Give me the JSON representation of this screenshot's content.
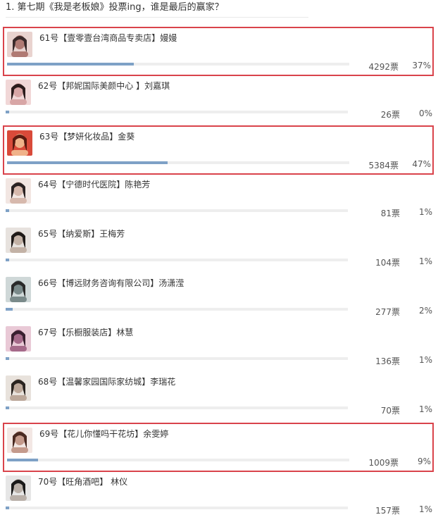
{
  "poll": {
    "title": "1. 第七期《我是老板娘》投票ing，谁是最后的赢家？",
    "unit": "票",
    "options": [
      {
        "label": "61号【壹零壹台湾商品专卖店】嫚嫚",
        "votes": "4292票",
        "percent": "37%",
        "share": 0.37,
        "highlighted": true,
        "avatar_icon": "avatar-photo"
      },
      {
        "label": "62号【邦妮国际美颜中心 】刘嘉琪",
        "votes": "26票",
        "percent": "0%",
        "share": 0.0,
        "highlighted": false,
        "avatar_icon": "avatar-photo"
      },
      {
        "label": "63号【梦妍化妆品】金葵",
        "votes": "5384票",
        "percent": "47%",
        "share": 0.47,
        "highlighted": true,
        "avatar_icon": "avatar-photo"
      },
      {
        "label": "64号【宁德时代医院】陈艳芳",
        "votes": "81票",
        "percent": "1%",
        "share": 0.01,
        "highlighted": false,
        "avatar_icon": "avatar-photo"
      },
      {
        "label": "65号【纳爱斯】王梅芳",
        "votes": "104票",
        "percent": "1%",
        "share": 0.01,
        "highlighted": false,
        "avatar_icon": "avatar-photo"
      },
      {
        "label": "66号【博远财务咨询有限公司】汤潇滢",
        "votes": "277票",
        "percent": "2%",
        "share": 0.02,
        "highlighted": false,
        "avatar_icon": "avatar-photo"
      },
      {
        "label": "67号【乐橱服装店】林慧",
        "votes": "136票",
        "percent": "1%",
        "share": 0.01,
        "highlighted": false,
        "avatar_icon": "avatar-photo"
      },
      {
        "label": "68号【温馨家园国际家纺城】李瑞花",
        "votes": "70票",
        "percent": "1%",
        "share": 0.01,
        "highlighted": false,
        "avatar_icon": "avatar-photo"
      },
      {
        "label": "69号【花儿你懂吗干花坊】余雯婷",
        "votes": "1009票",
        "percent": "9%",
        "share": 0.09,
        "highlighted": true,
        "avatar_icon": "avatar-photo"
      },
      {
        "label": "70号【旺角酒吧】 林仪",
        "votes": "157票",
        "percent": "1%",
        "share": 0.01,
        "highlighted": false,
        "avatar_icon": "avatar-photo"
      }
    ]
  },
  "colors": {
    "highlight_border": "#d9434b",
    "bar_fill": "#7ea1c6",
    "bar_track": "#eeeeee"
  }
}
